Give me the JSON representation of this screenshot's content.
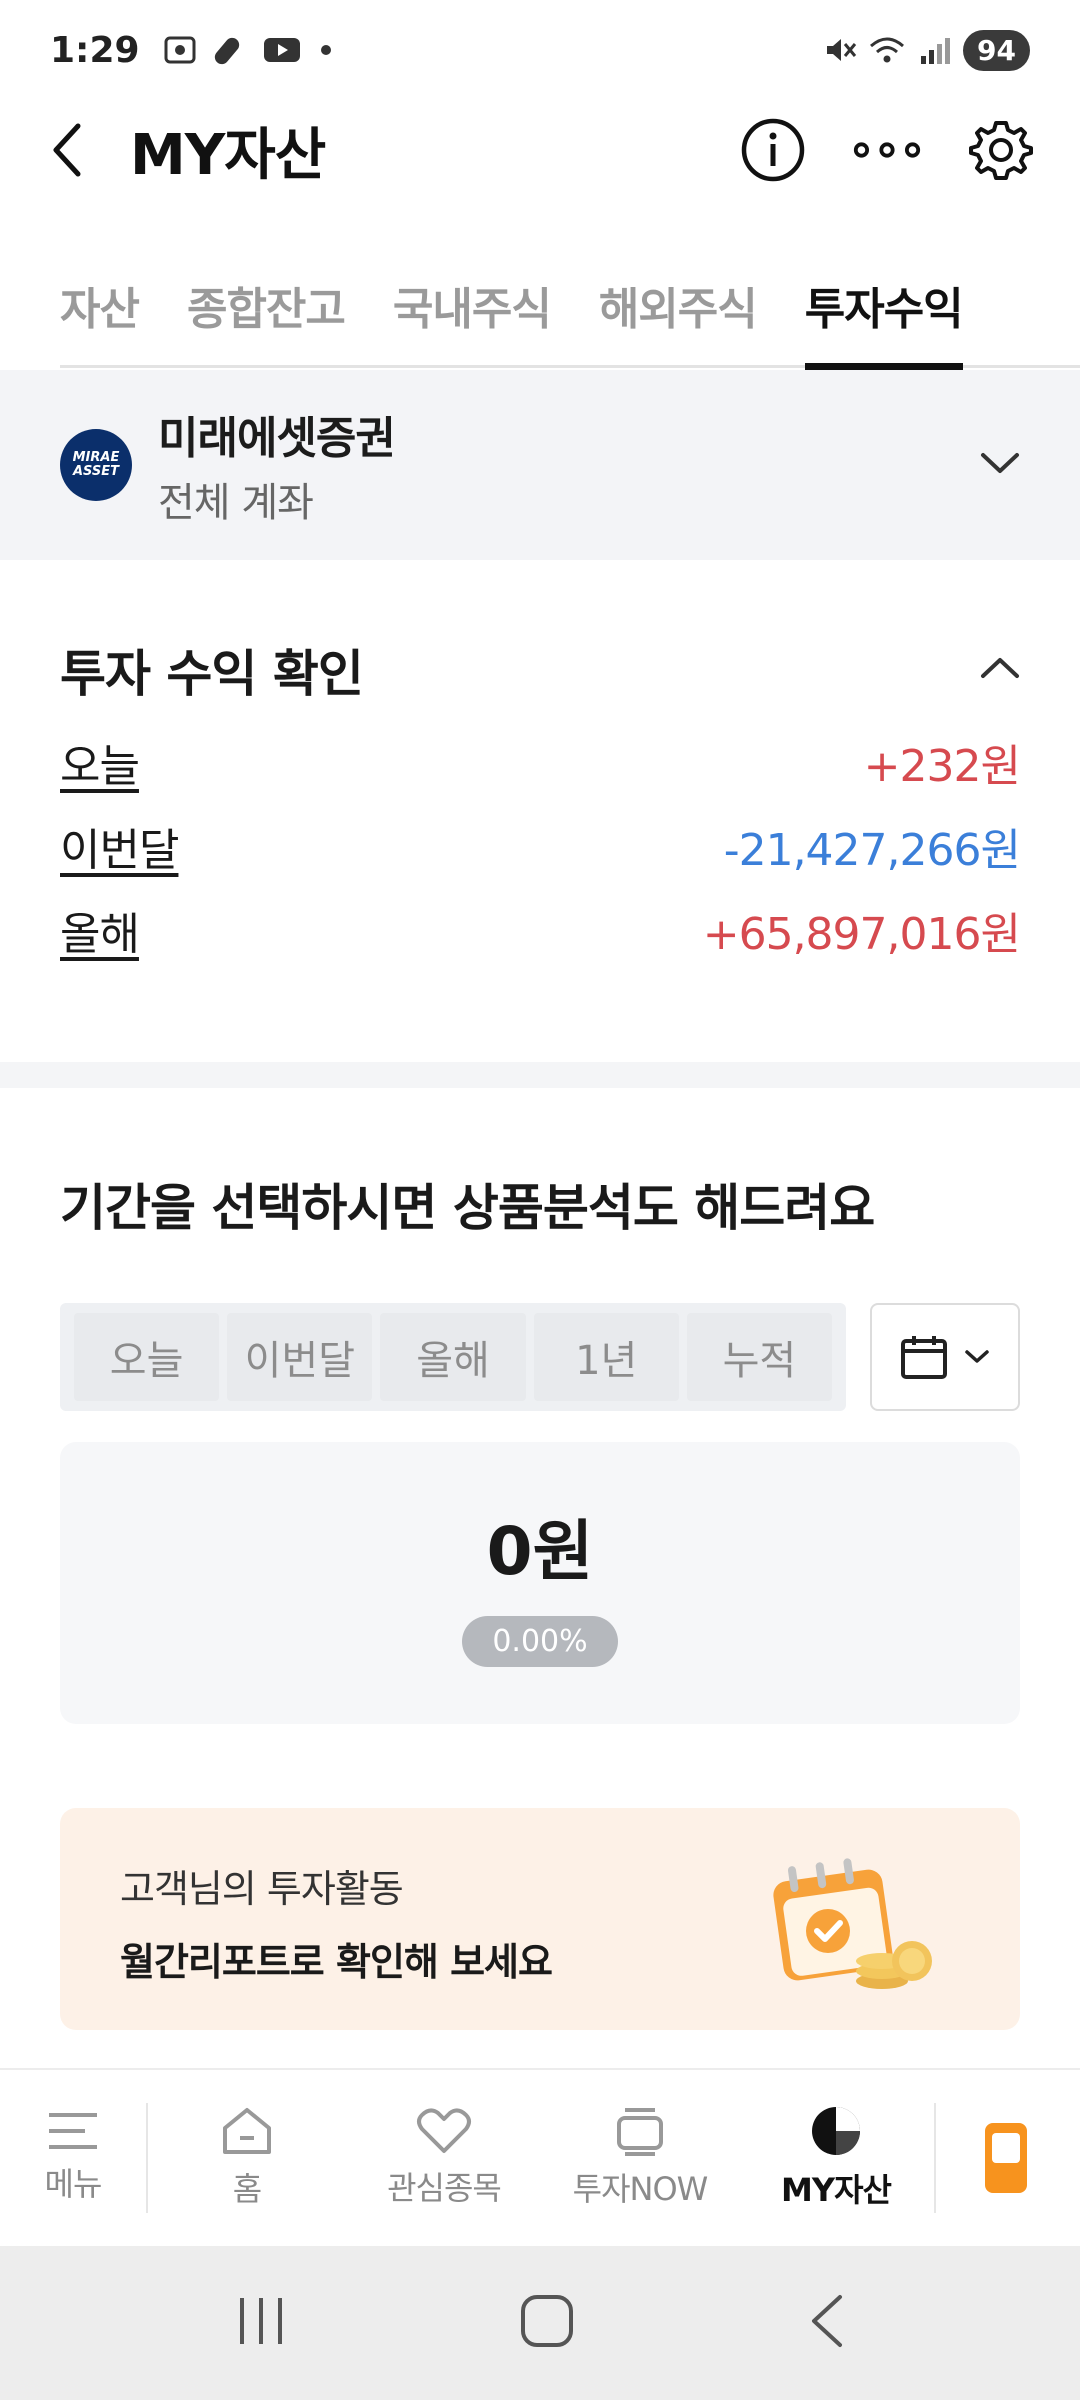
{
  "status_bar": {
    "time": "1:29",
    "battery": "94"
  },
  "header": {
    "title": "MY자산"
  },
  "tabs": [
    {
      "label": "자산",
      "active": false
    },
    {
      "label": "종합잔고",
      "active": false
    },
    {
      "label": "국내주식",
      "active": false
    },
    {
      "label": "해외주식",
      "active": false
    },
    {
      "label": "투자수익",
      "active": true
    }
  ],
  "account": {
    "logo_line1": "MIRAE",
    "logo_line2": "ASSET",
    "broker": "미래에셋증권",
    "scope": "전체 계좌"
  },
  "profit": {
    "title": "투자 수익 확인",
    "rows": [
      {
        "label": "오늘",
        "value": "+232원",
        "tone": "positive"
      },
      {
        "label": "이번달",
        "value": "-21,427,266원",
        "tone": "negative"
      },
      {
        "label": "올해",
        "value": "+65,897,016원",
        "tone": "positive"
      }
    ]
  },
  "period": {
    "title": "기간을 선택하시면 상품분석도 해드려요",
    "options": [
      "오늘",
      "이번달",
      "올해",
      "1년",
      "누적"
    ],
    "result_amount": "0원",
    "result_rate": "0.00%"
  },
  "promo": {
    "line1": "고객님의 투자활동",
    "line2": "월간리포트로 확인해 보세요"
  },
  "bottom_nav": [
    {
      "label": "메뉴",
      "icon": "menu-icon"
    },
    {
      "label": "홈",
      "icon": "home-icon"
    },
    {
      "label": "관심종목",
      "icon": "heart-icon"
    },
    {
      "label": "투자NOW",
      "icon": "cards-icon"
    },
    {
      "label": "MY자산",
      "icon": "pie-chart-icon",
      "active": true
    }
  ],
  "colors": {
    "positive": "#d64a4f",
    "negative": "#3b7fd9",
    "accent_orange": "#f7931e"
  }
}
